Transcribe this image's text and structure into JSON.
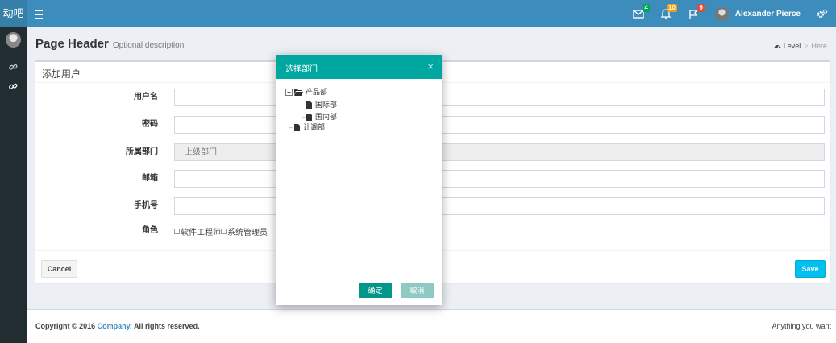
{
  "header": {
    "brand": "动吧",
    "badges": {
      "messages": "4",
      "notifications": "10",
      "tasks": "9"
    },
    "user_name": "Alexander Pierce"
  },
  "content_header": {
    "title": "Page Header",
    "description": "Optional description",
    "breadcrumb": {
      "level": "Level",
      "here": "Here"
    }
  },
  "form": {
    "box_title": "添加用户",
    "fields": [
      {
        "label": "用户名",
        "value": ""
      },
      {
        "label": "密码",
        "value": ""
      },
      {
        "label": "所属部门",
        "placeholder": "上级部门"
      },
      {
        "label": "邮箱",
        "value": ""
      },
      {
        "label": "手机号",
        "value": ""
      }
    ],
    "roles_label": "角色",
    "roles": [
      "软件工程师",
      "系统管理员"
    ],
    "cancel_label": "Cancel",
    "save_label": "Save"
  },
  "modal": {
    "title": "选择部门",
    "close": "×",
    "tree": {
      "root": "产品部",
      "children": [
        "国际部",
        "国内部"
      ],
      "sibling": "计调部"
    },
    "ok_label": "确定",
    "cancel_label": "取消"
  },
  "footer": {
    "copyright_prefix": "Copyright © 2016",
    "company": "Company.",
    "rights": "All rights reserved.",
    "right_text": "Anything you want"
  },
  "colors": {
    "header": "#3c8dbc",
    "sidebar": "#222d32",
    "modal_header": "#00a7a0",
    "save_button": "#00c0ef",
    "ok_button": "#009688"
  }
}
